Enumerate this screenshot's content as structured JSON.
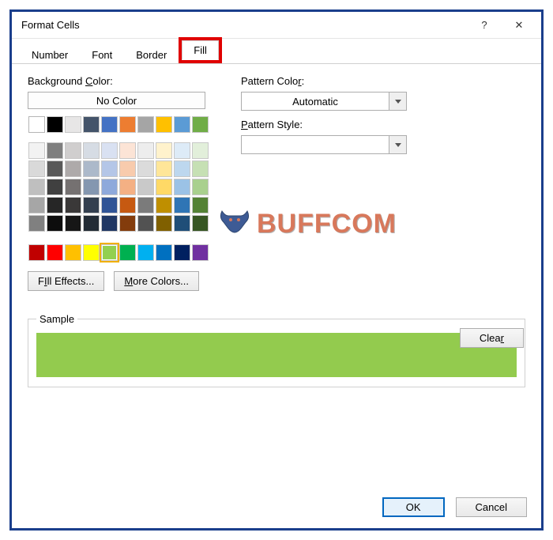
{
  "window": {
    "title": "Format Cells",
    "help_icon": "?",
    "close_icon": "✕"
  },
  "tabs": {
    "number": "Number",
    "font": "Font",
    "border": "Border",
    "fill": "Fill"
  },
  "labels": {
    "bg_color_pre": "Background ",
    "bg_color_u": "C",
    "bg_color_post": "olor:",
    "pattern_color_pre": "Pattern Colo",
    "pattern_color_u": "r",
    "pattern_color_post": ":",
    "pattern_style_pre": "",
    "pattern_style_u": "P",
    "pattern_style_post": "attern Style:",
    "no_color": "No Color",
    "automatic": "Automatic",
    "sample": "Sample"
  },
  "buttons": {
    "fill_effects_pre": "Fill Effects",
    "fill_effects_u": "I",
    "more_colors_u": "M",
    "more_colors_post": "ore Colors...",
    "clear": "Clea",
    "clear_u": "r",
    "ok": "OK",
    "cancel": "Cancel"
  },
  "palette": {
    "row0": [
      "#ffffff",
      "#000000",
      "#e7e6e6",
      "#44546a",
      "#4472c4",
      "#ed7d31",
      "#a5a5a5",
      "#ffc000",
      "#5b9bd5",
      "#70ad47"
    ],
    "theme": [
      [
        "#f2f2f2",
        "#7f7f7f",
        "#d0cece",
        "#d6dce4",
        "#d9e1f2",
        "#fce4d6",
        "#ededed",
        "#fff2cc",
        "#ddebf7",
        "#e2efda"
      ],
      [
        "#d9d9d9",
        "#595959",
        "#aeaaaa",
        "#acb9ca",
        "#b4c6e7",
        "#f8cbad",
        "#dbdbdb",
        "#ffe699",
        "#bdd7ee",
        "#c6e0b4"
      ],
      [
        "#bfbfbf",
        "#404040",
        "#757171",
        "#8497b0",
        "#8ea9db",
        "#f4b084",
        "#c9c9c9",
        "#ffd966",
        "#9bc2e6",
        "#a9d08e"
      ],
      [
        "#a6a6a6",
        "#262626",
        "#3a3838",
        "#333f4f",
        "#305496",
        "#c65911",
        "#7b7b7b",
        "#bf8f00",
        "#2f75b5",
        "#548235"
      ],
      [
        "#808080",
        "#0d0d0d",
        "#161616",
        "#222b35",
        "#203764",
        "#833c0c",
        "#525252",
        "#806000",
        "#1f4e78",
        "#375623"
      ]
    ],
    "standard": [
      "#c00000",
      "#ff0000",
      "#ffc000",
      "#ffff00",
      "#92d050",
      "#00b050",
      "#00b0f0",
      "#0070c0",
      "#002060",
      "#7030a0"
    ],
    "selected": "#92d050"
  },
  "watermark": {
    "text": "BUFFCOM"
  }
}
